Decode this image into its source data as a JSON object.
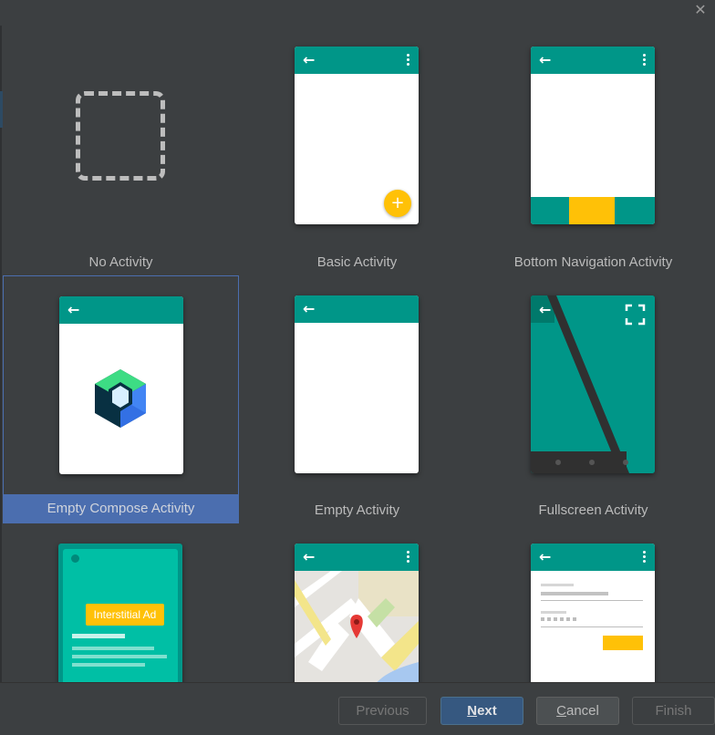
{
  "window": {
    "close_glyph": "✕"
  },
  "templates": [
    {
      "label": "No Activity",
      "icon": "dashed-square-icon",
      "selected": false
    },
    {
      "label": "Basic Activity",
      "icon": "basic-activity-preview",
      "selected": false
    },
    {
      "label": "Bottom Navigation Activity",
      "icon": "bottom-navigation-preview",
      "selected": false
    },
    {
      "label": "Empty Compose Activity",
      "icon": "jetpack-compose-logo-icon",
      "selected": true
    },
    {
      "label": "Empty Activity",
      "icon": "empty-activity-preview",
      "selected": false
    },
    {
      "label": "Fullscreen Activity",
      "icon": "fullscreen-activity-preview",
      "selected": false
    },
    {
      "label": "",
      "icon": "interstitial-ad-preview",
      "selected": false,
      "ad_text": "Interstitial Ad"
    },
    {
      "label": "",
      "icon": "google-maps-preview",
      "selected": false
    },
    {
      "label": "",
      "icon": "login-activity-preview",
      "selected": false
    }
  ],
  "glyphs": {
    "back_arrow": "←",
    "fab_plus": "+"
  },
  "buttons": {
    "previous": {
      "label": "Previous",
      "enabled": false
    },
    "next": {
      "label_mnemonic": "N",
      "label_rest": "ext",
      "enabled": true
    },
    "cancel": {
      "label_mnemonic": "C",
      "label_rest": "ancel",
      "enabled": true
    },
    "finish": {
      "label": "Finish",
      "enabled": false
    }
  },
  "colors": {
    "teal": "#009688",
    "amber": "#ffc107",
    "selection": "#4b6eaf",
    "background": "#3c3f41"
  }
}
